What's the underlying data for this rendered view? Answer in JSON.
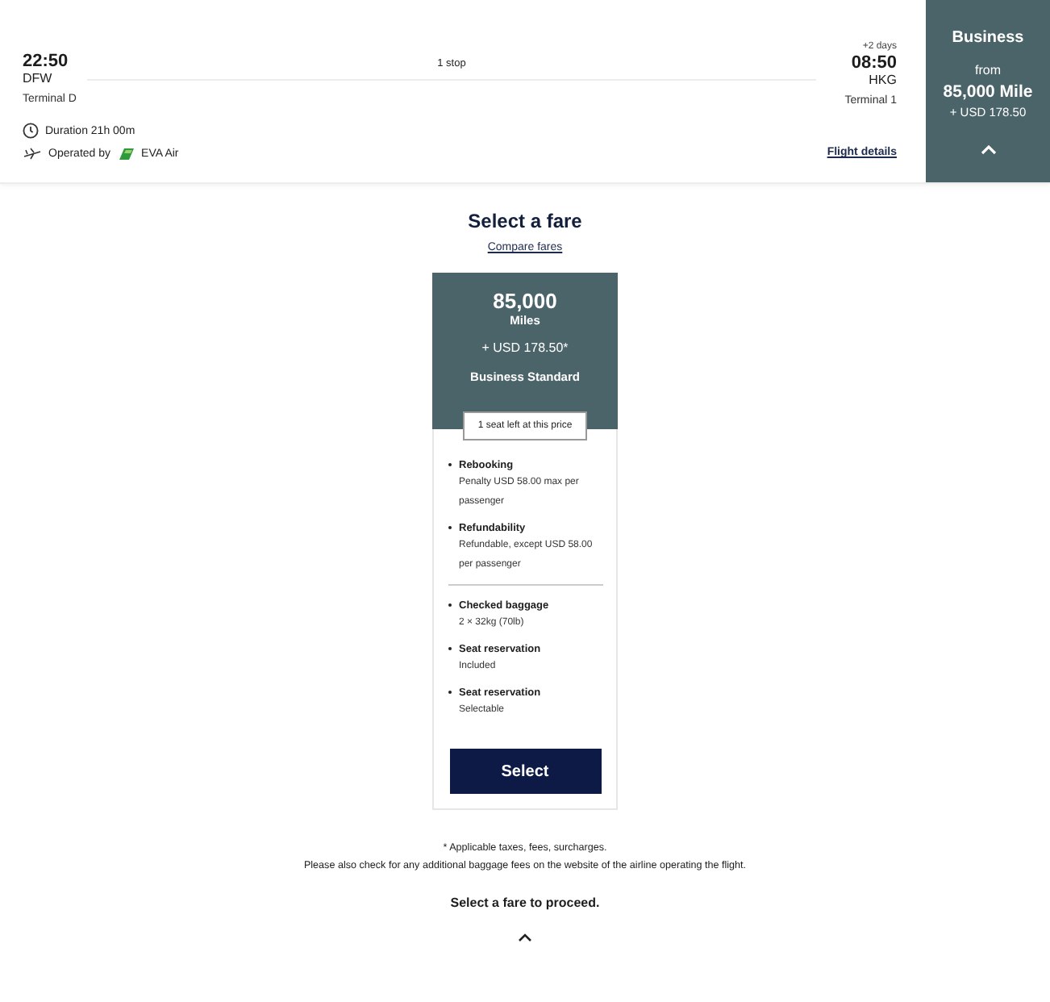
{
  "flight": {
    "departure": {
      "time": "22:50",
      "airport": "DFW",
      "terminal": "Terminal D"
    },
    "stops": "1 stop",
    "arrival": {
      "day_offset": "+2 days",
      "time": "08:50",
      "airport": "HKG",
      "terminal": "Terminal 1"
    },
    "duration": "Duration 21h 00m",
    "operated_by": "Operated by",
    "airline": "EVA Air",
    "details_link": "Flight details"
  },
  "cabin_panel": {
    "title": "Business",
    "from": "from",
    "miles": "85,000 Mile",
    "price": "+ USD 178.50",
    "expanded": true
  },
  "fare_section": {
    "title": "Select a fare",
    "compare_link": "Compare fares"
  },
  "fare_card": {
    "miles": "85,000",
    "miles_unit": "Miles",
    "price": "+ USD 178.50*",
    "name": "Business Standard",
    "availability": "1 seat left at this price",
    "benefit_groups": [
      [
        {
          "title": "Rebooking",
          "detail": "Penalty USD 58.00 max per passenger"
        },
        {
          "title": "Refundability",
          "detail": "Refundable, except USD 58.00 per passenger"
        }
      ],
      [
        {
          "title": "Checked baggage",
          "detail": "2 × 32kg (70lb)"
        },
        {
          "title": "Seat reservation",
          "detail": "Included"
        },
        {
          "title": "Seat reservation",
          "detail": "Selectable"
        }
      ]
    ],
    "button": "Select"
  },
  "footnotes": [
    "* Applicable taxes, fees, surcharges.",
    "Please also check for any additional baggage fees on the website of the airline operating the flight."
  ],
  "prompt": "Select a fare to proceed."
}
